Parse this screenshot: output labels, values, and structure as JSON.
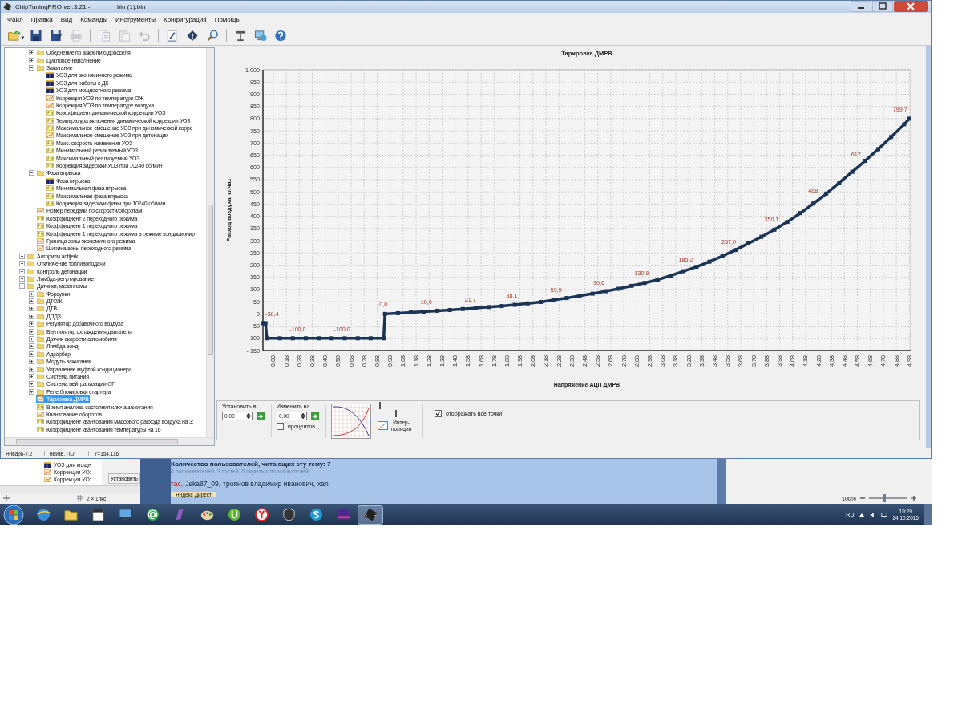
{
  "window": {
    "title": "ChipTuningPRO ver.3.21 - _______bin (1).bin"
  },
  "menu": [
    "Файл",
    "Правка",
    "Вид",
    "Команды",
    "Инструменты",
    "Конфигурация",
    "Помощь"
  ],
  "toolbar": [
    {
      "kind": "open",
      "disabled": false
    },
    {
      "kind": "save",
      "disabled": false
    },
    {
      "kind": "save-as",
      "disabled": false
    },
    {
      "kind": "print",
      "disabled": true
    },
    {
      "kind": "separator"
    },
    {
      "kind": "copy",
      "disabled": true
    },
    {
      "kind": "paste",
      "disabled": true
    },
    {
      "kind": "undo",
      "disabled": true
    },
    {
      "kind": "separator"
    },
    {
      "kind": "document",
      "disabled": false
    },
    {
      "kind": "diamond",
      "disabled": false
    },
    {
      "kind": "search",
      "disabled": false
    },
    {
      "kind": "separator"
    },
    {
      "kind": "tool",
      "disabled": false
    },
    {
      "kind": "monitor",
      "disabled": false
    },
    {
      "kind": "help",
      "disabled": false
    }
  ],
  "tree": [
    {
      "children": [
        {
          "kind": "folder",
          "label": "Обеднение по закрытию дросселя",
          "expanded": false,
          "selected": false
        },
        {
          "kind": "folder",
          "label": "Цикловое наполнение",
          "expanded": false,
          "selected": false
        },
        {
          "kind": "folder",
          "label": "Зажигание",
          "expanded": true,
          "selected": false,
          "children": [
            {
              "kind": "map",
              "label": "УОЗ для экономичного режима",
              "selected": false
            },
            {
              "kind": "map",
              "label": "УОЗ для работы с ДК",
              "selected": false
            },
            {
              "kind": "map",
              "label": "УОЗ для мощностного режима",
              "selected": false
            },
            {
              "kind": "curve",
              "label": "Коррекция УОЗ по температуре ОЖ",
              "selected": false
            },
            {
              "kind": "curve",
              "label": "Коррекция УОЗ по температуре воздуха",
              "selected": false
            },
            {
              "kind": "const",
              "label": "Коэффициент динамической коррекции УОЗ",
              "selected": false
            },
            {
              "kind": "const",
              "label": "Температура включения динамической коррекции УОЗ",
              "selected": false
            },
            {
              "kind": "const",
              "label": "Максимальное смещение УОЗ при динамической корре",
              "selected": false
            },
            {
              "kind": "curve",
              "label": "Максимальное смещение УОЗ при детонации",
              "selected": false
            },
            {
              "kind": "const",
              "label": "Макс. скорость изменения УОЗ",
              "selected": false
            },
            {
              "kind": "const",
              "label": "Минимальный реализуемый УОЗ",
              "selected": false
            },
            {
              "kind": "const",
              "label": "Максимальный реализуемый УОЗ",
              "selected": false
            },
            {
              "kind": "const",
              "label": "Коррекция задержки УОЗ при 10240 об/мин",
              "selected": false
            }
          ]
        },
        {
          "kind": "folder",
          "label": "Фаза впрыска",
          "expanded": true,
          "selected": false,
          "children": [
            {
              "kind": "map",
              "label": "Фаза впрыска",
              "selected": false
            },
            {
              "kind": "const",
              "label": "Минимальная фаза впрыска",
              "selected": false
            },
            {
              "kind": "const",
              "label": "Максимальная фаза впрыска",
              "selected": false
            },
            {
              "kind": "const",
              "label": "Коррекция задержки фазы при 10240 об/мин",
              "selected": false
            }
          ]
        },
        {
          "kind": "curve",
          "label": "Номер передачи по скорости/оборотам",
          "selected": false
        },
        {
          "kind": "const",
          "label": "Коэффициент 2 переходного режима",
          "selected": false
        },
        {
          "kind": "const",
          "label": "Коэффициент 1 переходного режима",
          "selected": false
        },
        {
          "kind": "const",
          "label": "Коэффициент 1 переходного режима в режиме кондиционир",
          "selected": false
        },
        {
          "kind": "curve",
          "label": "Граница зоны экономичного режима",
          "selected": false
        },
        {
          "kind": "curve",
          "label": "Ширина зоны переходного режима",
          "selected": false
        }
      ]
    },
    {
      "kind": "folder",
      "label": "Алгоритм antijerk",
      "expanded": false,
      "selected": false
    },
    {
      "kind": "folder",
      "label": "Отключение топливоподачи",
      "expanded": false,
      "selected": false
    },
    {
      "kind": "folder",
      "label": "Контроль детонации",
      "expanded": false,
      "selected": false
    },
    {
      "kind": "folder",
      "label": "Лямбда-регулирование",
      "expanded": false,
      "selected": false
    },
    {
      "kind": "folder",
      "label": "Датчики, механизмы",
      "expanded": true,
      "selected": false,
      "children": [
        {
          "kind": "folder",
          "label": "Форсунки",
          "expanded": false,
          "selected": false
        },
        {
          "kind": "folder",
          "label": "ДТОЖ",
          "expanded": false,
          "selected": false
        },
        {
          "kind": "folder",
          "label": "ДТВ",
          "expanded": false,
          "selected": false
        },
        {
          "kind": "folder",
          "label": "ДПДЗ",
          "expanded": false,
          "selected": false
        },
        {
          "kind": "folder",
          "label": "Регулятор добавочного воздуха",
          "expanded": false,
          "selected": false
        },
        {
          "kind": "folder",
          "label": "Вентилятор охлаждения двигателя",
          "expanded": false,
          "selected": false
        },
        {
          "kind": "folder",
          "label": "Датчик скорости автомобиля",
          "expanded": false,
          "selected": false
        },
        {
          "kind": "folder",
          "label": "Лямбда-зонд",
          "expanded": false,
          "selected": false
        },
        {
          "kind": "folder",
          "label": "Адсорбер",
          "expanded": false,
          "selected": false
        },
        {
          "kind": "folder",
          "label": "Модуль зажигания",
          "expanded": false,
          "selected": false
        },
        {
          "kind": "folder",
          "label": "Управление муфтой кондиционера",
          "expanded": false,
          "selected": false
        },
        {
          "kind": "folder",
          "label": "Система питания",
          "expanded": false,
          "selected": false
        },
        {
          "kind": "folder",
          "label": "Система нейтрализации ОГ",
          "expanded": false,
          "selected": false
        },
        {
          "kind": "folder",
          "label": "Реле блокировки стартера",
          "expanded": false,
          "selected": false
        },
        {
          "kind": "curve",
          "label": "Тарировка ДМРВ",
          "selected": true
        },
        {
          "kind": "const",
          "label": "Время анализа состояния ключа зажигания",
          "selected": false
        },
        {
          "kind": "curve",
          "label": "Квантование оборотов",
          "selected": false
        },
        {
          "kind": "const",
          "label": "Коэффициент квантования массового расхода воздуха на 3:",
          "selected": false
        },
        {
          "kind": "const",
          "label": "Коэффициент квантования температуры на 16",
          "selected": false
        }
      ]
    }
  ],
  "status_bar": [
    "Январь-7.2",
    "неизв. ПО",
    "Y=154,116"
  ],
  "chart_panel": {
    "chart_data": {
      "type": "line",
      "title": "Тарировка ДМРВ",
      "xlabel": "Напряжение АЦП ДМРВ",
      "ylabel": "Расход воздуха, кг/час",
      "xlim": [
        0,
        4.99
      ],
      "ylim": [
        -150,
        1000
      ],
      "x": [
        0,
        0.02,
        0.03,
        0.13,
        0.23,
        0.33,
        0.43,
        0.53,
        0.63,
        0.73,
        0.83,
        0.93,
        0.94,
        1.04,
        1.14,
        1.24,
        1.34,
        1.44,
        1.54,
        1.64,
        1.74,
        1.84,
        1.94,
        2.04,
        2.14,
        2.24,
        2.34,
        2.44,
        2.54,
        2.64,
        2.74,
        2.84,
        2.94,
        3.04,
        3.14,
        3.24,
        3.34,
        3.44,
        3.54,
        3.64,
        3.74,
        3.84,
        3.94,
        4.04,
        4.14,
        4.24,
        4.34,
        4.44,
        4.54,
        4.64,
        4.74,
        4.84,
        4.94,
        4.98
      ],
      "grid": true,
      "series": [
        {
          "color": "#1b3456",
          "marker": "square",
          "values": [
            -38,
            -38,
            -100,
            -100,
            -100,
            -100,
            -100,
            -100,
            -100,
            -100,
            -100,
            -100,
            0,
            3,
            6,
            9,
            13,
            16,
            20,
            24,
            28,
            32,
            37,
            43,
            49,
            57,
            65,
            74,
            83,
            93,
            103,
            115,
            127,
            140,
            157,
            175,
            193,
            214,
            237,
            262,
            289,
            316,
            345,
            377,
            413,
            452,
            493,
            537,
            582,
            627,
            675,
            725,
            777,
            800
          ]
        }
      ],
      "yticks": [
        {
          "value": -150,
          "label": "- 150"
        },
        {
          "value": -100,
          "label": "- 100"
        },
        {
          "value": -50,
          "label": "- 50"
        },
        0,
        50,
        100,
        150,
        200,
        250,
        300,
        350,
        400,
        450,
        500,
        550,
        600,
        650,
        700,
        750,
        800,
        850,
        900,
        950,
        {
          "value": 1000,
          "label": "1 000"
        }
      ],
      "xticks": [
        {
          "value": 0.08,
          "label": "0,08"
        },
        {
          "value": 0.18,
          "label": "0,18"
        },
        {
          "value": 0.28,
          "label": "0,28"
        },
        {
          "value": 0.38,
          "label": "0,38"
        },
        {
          "value": 0.48,
          "label": "0,48"
        },
        {
          "value": 0.58,
          "label": "0,58"
        },
        {
          "value": 0.68,
          "label": "0,68"
        },
        {
          "value": 0.78,
          "label": "0,78"
        },
        {
          "value": 0.88,
          "label": "0,88"
        },
        {
          "value": 0.98,
          "label": "0,98"
        },
        {
          "value": 1.08,
          "label": "1,08"
        },
        {
          "value": 1.18,
          "label": "1,18"
        },
        {
          "value": 1.28,
          "label": "1,28"
        },
        {
          "value": 1.38,
          "label": "1,38"
        },
        {
          "value": 1.48,
          "label": "1,48"
        },
        {
          "value": 1.58,
          "label": "1,58"
        },
        {
          "value": 1.68,
          "label": "1,68"
        },
        {
          "value": 1.78,
          "label": "1,78"
        },
        {
          "value": 1.88,
          "label": "1,88"
        },
        {
          "value": 1.98,
          "label": "1,98"
        },
        {
          "value": 2.08,
          "label": "2,08"
        },
        {
          "value": 2.18,
          "label": "2,18"
        },
        {
          "value": 2.28,
          "label": "2,28"
        },
        {
          "value": 2.38,
          "label": "2,38"
        },
        {
          "value": 2.48,
          "label": "2,48"
        },
        {
          "value": 2.58,
          "label": "2,58"
        },
        {
          "value": 2.68,
          "label": "2,68"
        },
        {
          "value": 2.78,
          "label": "2,78"
        },
        {
          "value": 2.88,
          "label": "2,88"
        },
        {
          "value": 2.98,
          "label": "2,98"
        },
        {
          "value": 3.08,
          "label": "3,08"
        },
        {
          "value": 3.18,
          "label": "3,18"
        },
        {
          "value": 3.28,
          "label": "3,28"
        },
        {
          "value": 3.38,
          "label": "3,38"
        },
        {
          "value": 3.48,
          "label": "3,48"
        },
        {
          "value": 3.58,
          "label": "3,58"
        },
        {
          "value": 3.68,
          "label": "3,68"
        },
        {
          "value": 3.78,
          "label": "3,78"
        },
        {
          "value": 3.88,
          "label": "3,88"
        },
        {
          "value": 3.98,
          "label": "3,98"
        },
        {
          "value": 4.08,
          "label": "4,08"
        },
        {
          "value": 4.18,
          "label": "4,18"
        },
        {
          "value": 4.28,
          "label": "4,28"
        },
        {
          "value": 4.38,
          "label": "4,38"
        },
        {
          "value": 4.48,
          "label": "4,48"
        },
        {
          "value": 4.58,
          "label": "4,58"
        },
        {
          "value": 4.68,
          "label": "4,68"
        },
        {
          "value": 4.78,
          "label": "4,78"
        },
        {
          "value": 4.88,
          "label": "4,88"
        },
        {
          "value": 4.98,
          "label": "4,98"
        }
      ],
      "annotations": [
        {
          "x": 0.02,
          "y": -38.4,
          "text": "-38,4"
        },
        {
          "x": 0.33,
          "y": -100,
          "text": "-100,0"
        },
        {
          "x": 0.67,
          "y": -100,
          "text": "-100,0"
        },
        {
          "x": 0.99,
          "y": 0,
          "text": "0,0"
        },
        {
          "x": 1.32,
          "y": 10,
          "text": "10,0"
        },
        {
          "x": 1.66,
          "y": 21.7,
          "text": "21,7"
        },
        {
          "x": 1.98,
          "y": 38.1,
          "text": "38,1"
        },
        {
          "x": 2.32,
          "y": 59.9,
          "text": "59,9"
        },
        {
          "x": 2.65,
          "y": 90.6,
          "text": "90,6"
        },
        {
          "x": 2.98,
          "y": 130.9,
          "text": "130,9"
        },
        {
          "x": 3.32,
          "y": 185.2,
          "text": "185,2"
        },
        {
          "x": 3.65,
          "y": 257,
          "text": "257,0"
        },
        {
          "x": 3.98,
          "y": 350.1,
          "text": "350,1"
        },
        {
          "x": 4.3,
          "y": 468,
          "text": "468"
        },
        {
          "x": 4.63,
          "y": 617,
          "text": "617"
        },
        {
          "x": 4.97,
          "y": 799.7,
          "text": "799,7"
        }
      ]
    },
    "controls": {
      "set_to": {
        "label": "Установить в",
        "value": "0,00"
      },
      "change_by": {
        "label": "Изменить на",
        "value": "0,00"
      },
      "percent": {
        "label": "процентов",
        "checked": false
      },
      "sliders": [
        {
          "level": 0.05
        },
        {
          "level": 0.45
        }
      ],
      "interpolation": {
        "label": "Интер-\nполяция"
      },
      "show_all_points": {
        "label": "отображать все точки",
        "checked": true
      }
    }
  },
  "background": {
    "left_app": {
      "items": [
        {
          "kind": "map",
          "label": "УОЗ для мощн"
        },
        {
          "kind": "curve",
          "label": "Коррекция УО:"
        },
        {
          "kind": "curve",
          "label": "Коррекция УО:"
        }
      ],
      "button": "Установить",
      "status": "2 × 1пкс"
    },
    "forum": {
      "heading": "Количество пользователей, читающих эту тему: 7",
      "summary": "4 пользователей, 3 гостей, 0 скрытых пользователей",
      "users": [
        {
          "name": "тас,",
          "kind": "moderator"
        },
        {
          "name": "Jeka87_09,",
          "kind": "member"
        },
        {
          "name": "троянов владимир иванович,",
          "kind": "member"
        },
        {
          "name": "xan",
          "kind": "member"
        }
      ],
      "ad_tag": "Яндекс Директ"
    },
    "right_app": {
      "zoom": "100%",
      "level": 0.4
    }
  },
  "taskbar": {
    "apps": [
      {
        "kind": "globe",
        "selected": false
      },
      {
        "kind": "folder",
        "selected": false
      },
      {
        "kind": "calendar",
        "selected": false
      },
      {
        "kind": "monitor",
        "selected": false
      },
      {
        "kind": "at",
        "selected": false
      },
      {
        "kind": "pen",
        "selected": false
      },
      {
        "kind": "palette",
        "selected": false
      },
      {
        "kind": "torrent",
        "selected": false
      },
      {
        "kind": "circle",
        "selected": false
      },
      {
        "kind": "shield",
        "selected": false
      },
      {
        "kind": "skype",
        "selected": false
      },
      {
        "kind": "hex",
        "selected": false
      },
      {
        "kind": "chip",
        "selected": true
      }
    ],
    "language": "RU",
    "time": "19:29",
    "date": "24.10.2015"
  }
}
